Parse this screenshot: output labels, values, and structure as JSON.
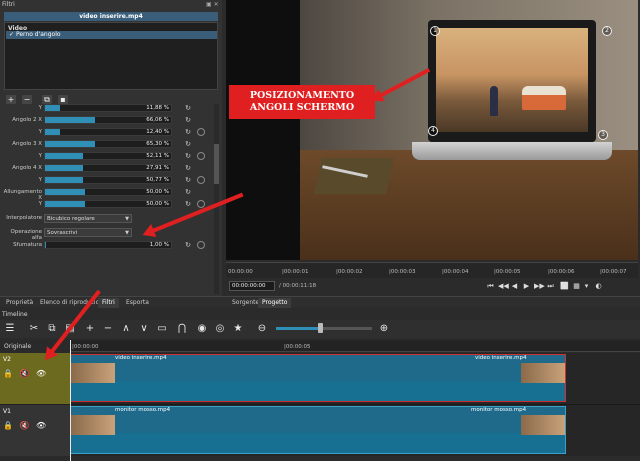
{
  "filters_panel": {
    "title": "Filtri",
    "controls": "▣ ✕",
    "clip_title": "video inserire.mp4",
    "category": "Video",
    "filter_item": "Perno d'angolo",
    "toolbar": [
      "+",
      "−",
      "⧉",
      "▪"
    ],
    "params": [
      {
        "label": "Y",
        "value": "11,88 %",
        "fraction": 0.12
      },
      {
        "label": "Angolo 2 X",
        "value": "66,06 %",
        "fraction": 0.4
      },
      {
        "label": "Y",
        "value": "12,40 %",
        "fraction": 0.12
      },
      {
        "label": "Angolo 3 X",
        "value": "65,30 %",
        "fraction": 0.4
      },
      {
        "label": "Y",
        "value": "52,11 %",
        "fraction": 0.3
      },
      {
        "label": "Angolo 4 X",
        "value": "27,91 %",
        "fraction": 0.3
      },
      {
        "label": "Y",
        "value": "50,77 %",
        "fraction": 0.3
      },
      {
        "label": "Allungamento X",
        "value": "50,00 %",
        "fraction": 0.32
      },
      {
        "label": "Y",
        "value": "50,00 %",
        "fraction": 0.32
      }
    ],
    "interpolation_label": "Interpolatore",
    "interpolation_value": "Bicubico regolare",
    "alpha_label": "Operazione alfa",
    "alpha_value": "Sovrascrivi",
    "feather_label": "Sfumatura",
    "feather_value": "1,00 %",
    "feather_fraction": 0.01
  },
  "preview": {
    "callout": "POSIZIONAMENTO ANGOLI SCHERMO",
    "corners": [
      "1",
      "2",
      "3",
      "4"
    ]
  },
  "ruler": {
    "ticks": [
      "00:00:00",
      "|00:00:01",
      "|00:00:02",
      "|00:00:03",
      "|00:00:04",
      "|00:00:05",
      "|00:00:06",
      "|00:00:07"
    ]
  },
  "transport": {
    "timecode": "00:00:00:00",
    "duration": "/ 00:00:11:18",
    "buttons": [
      "⏮",
      "◀◀",
      "◀",
      "▶",
      "▶▶",
      "⏭",
      "⬜",
      "▦",
      "▾",
      "◐"
    ]
  },
  "tabs": [
    "Proprietà",
    "Elenco di riproduzione",
    "Filtri",
    "Esporta",
    "Sorgente",
    "Progetto"
  ],
  "timeline": {
    "title": "Timeline",
    "toolbar": [
      "☰",
      "✂",
      "⧉",
      "▤",
      "+",
      "−",
      "∧",
      "∨",
      "▭",
      "⋂",
      "◉",
      "◎",
      "★",
      "⊖",
      "⊕"
    ],
    "master_label": "Originale",
    "ruler": [
      "|00:00:00",
      "|00:00:05"
    ],
    "tracks": [
      {
        "name": "V2",
        "icons": "🔒 🔇 👁",
        "clip_start": "video inserire.mp4",
        "clip_end": "video inserire.mp4"
      },
      {
        "name": "V1",
        "icons": "🔒 🔇 👁",
        "clip_start": "monitor mosso.mp4",
        "clip_end": "monitor mosso.mp4"
      }
    ]
  }
}
